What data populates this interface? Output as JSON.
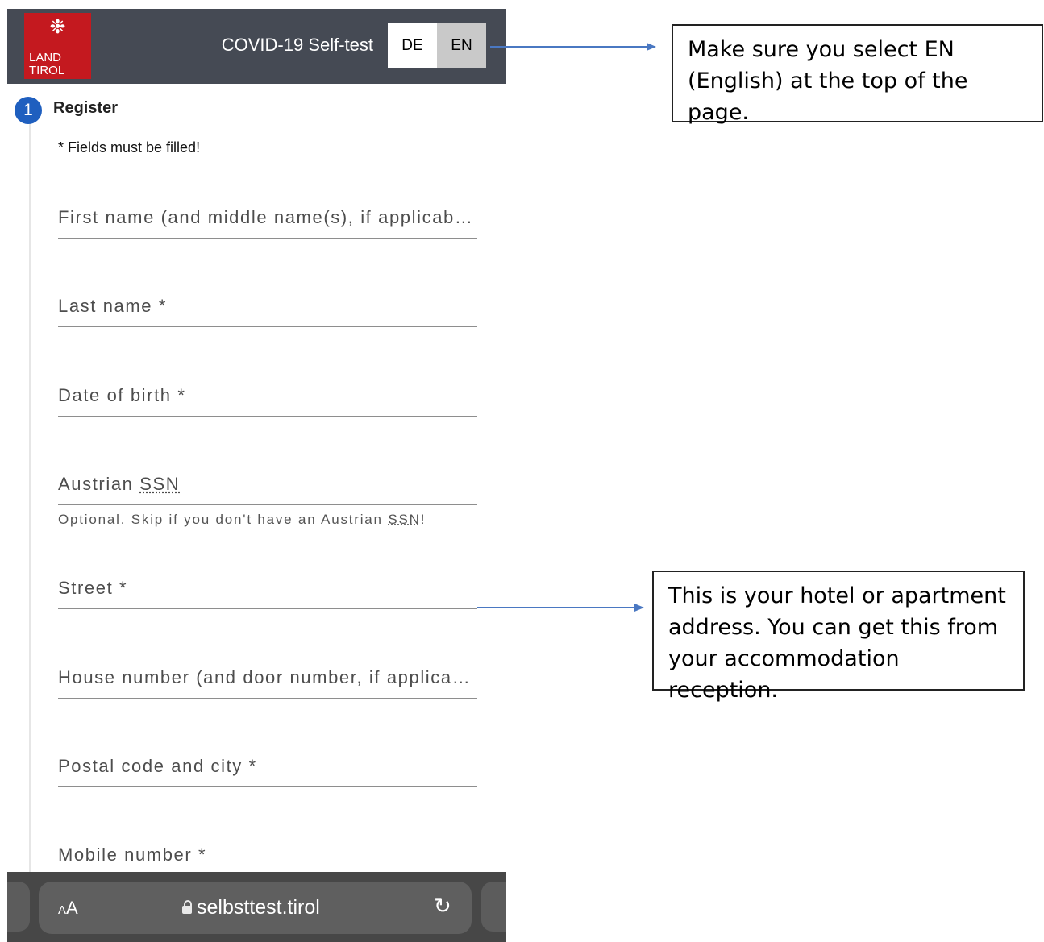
{
  "header": {
    "logo_line1": "LAND",
    "logo_line2": "TIROL",
    "title": "COVID-19 Self-test",
    "languages": [
      {
        "code": "DE",
        "selected": false
      },
      {
        "code": "EN",
        "selected": true
      }
    ]
  },
  "step": {
    "number": "1",
    "label": "Register",
    "required_note": "* Fields must be filled!"
  },
  "form": {
    "fields": [
      {
        "placeholder": "First name (and middle name(s), if applicable) *",
        "value": ""
      },
      {
        "placeholder": "Last name *",
        "value": ""
      },
      {
        "placeholder": "Date of birth *",
        "value": ""
      },
      {
        "placeholder_prefix": "Austrian ",
        "placeholder_abbr": "SSN",
        "value": ""
      },
      {
        "placeholder": "Street *",
        "value": ""
      },
      {
        "placeholder": "House number (and door number, if applicable) *",
        "value": ""
      },
      {
        "placeholder": "Postal code and city *",
        "value": ""
      },
      {
        "placeholder": "Mobile number *",
        "value": ""
      }
    ],
    "ssn_hint_prefix": "Optional. Skip if you don't have an Austrian ",
    "ssn_hint_abbr": "SSN",
    "ssn_hint_suffix": "!"
  },
  "browser": {
    "text_size_label_small": "A",
    "text_size_label_large": "A",
    "url": "selbsttest.tirol",
    "reload_icon": "reload-icon"
  },
  "annotations": {
    "language_tip": "Make sure you select EN (English) at the top of the page.",
    "address_tip": "This is your hotel or apartment address. You can get this from your accommodation reception."
  },
  "colors": {
    "header_bg": "#454a54",
    "logo_red": "#c4191f",
    "step_blue": "#1f5fbf",
    "selected_lang_bg": "#c9c9c9",
    "arrow_blue": "#4a78c2"
  }
}
